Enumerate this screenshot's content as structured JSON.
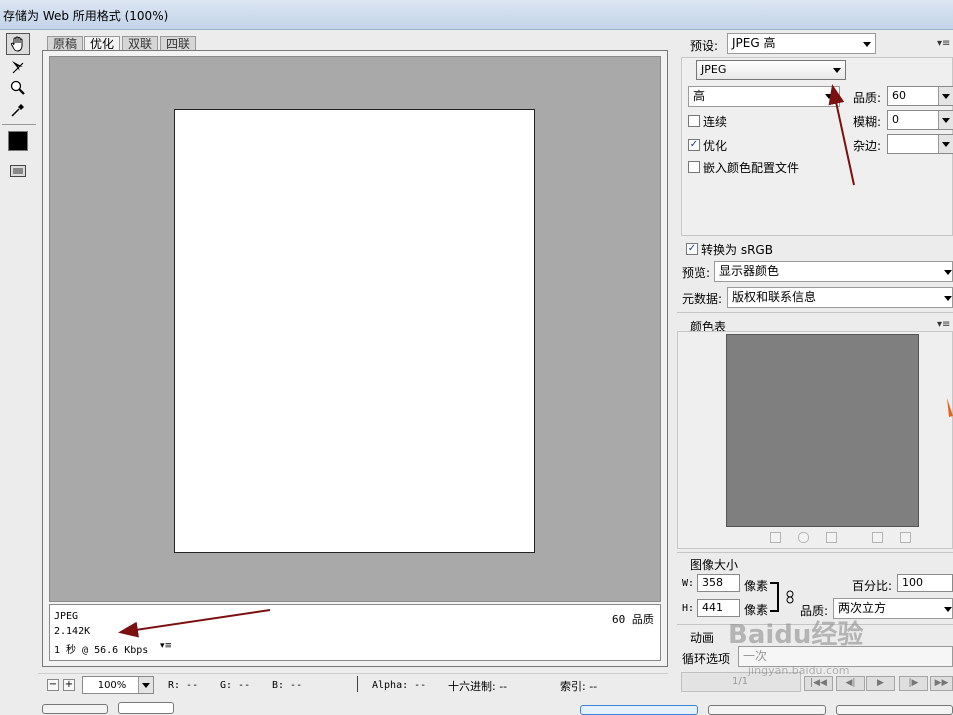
{
  "window": {
    "title": "存储为 Web 所用格式 (100%)"
  },
  "tools": [
    {
      "name": "hand-tool-icon"
    },
    {
      "name": "slice-select-tool-icon"
    },
    {
      "name": "zoom-tool-icon"
    },
    {
      "name": "eyedropper-tool-icon"
    },
    {
      "name": "color-swatch-icon"
    },
    {
      "name": "toggle-slices-icon"
    }
  ],
  "tabs": [
    {
      "label": "原稿"
    },
    {
      "label": "优化"
    },
    {
      "label": "双联"
    },
    {
      "label": "四联"
    }
  ],
  "info": {
    "format": "JPEG",
    "size": "2.142K",
    "download": "1 秒 @ 56.6 Kbps",
    "quality_label": "60 品质"
  },
  "status": {
    "zoom": "100%",
    "r": "R: --",
    "g": "G: --",
    "b": "B: --",
    "alpha": "Alpha: --",
    "hex": "十六进制: --",
    "index": "索引: --"
  },
  "settings": {
    "preset_label": "预设:",
    "preset_value": "JPEG 高",
    "format_value": "JPEG",
    "quality_level": "高",
    "quality_label": "品质:",
    "quality_value": "60",
    "blur_label": "模糊:",
    "blur_value": "0",
    "matte_label": "杂边:",
    "matte_value": "",
    "progressive_label": "连续",
    "progressive_checked": false,
    "optimized_label": "优化",
    "optimized_checked": true,
    "embed_profile_label": "嵌入颜色配置文件",
    "embed_profile_checked": false,
    "convert_srgb_label": "转换为 sRGB",
    "convert_srgb_checked": true,
    "preview_label": "预览:",
    "preview_value": "显示器颜色",
    "metadata_label": "元数据:",
    "metadata_value": "版权和联系信息"
  },
  "color_table": {
    "title": "颜色表",
    "swatch_color": "#7f7f7f"
  },
  "image_size": {
    "title": "图像大小",
    "w_label": "W:",
    "w_value": "358",
    "h_label": "H:",
    "h_value": "441",
    "unit": "像素",
    "percent_label": "百分比:",
    "percent_value": "100",
    "quality_label": "品质:",
    "quality_value": "两次立方"
  },
  "animation": {
    "title": "动画",
    "loop_label": "循环选项",
    "loop_value": "一次",
    "frame_counter": "1/1"
  },
  "watermark": {
    "text": "Baidu经验",
    "url": "jingyan.baidu.com"
  },
  "colors": {
    "annotation_arrow": "#7a1010",
    "canvas_bg": "#a9a9a9",
    "accent_orange": "#e8641e"
  }
}
